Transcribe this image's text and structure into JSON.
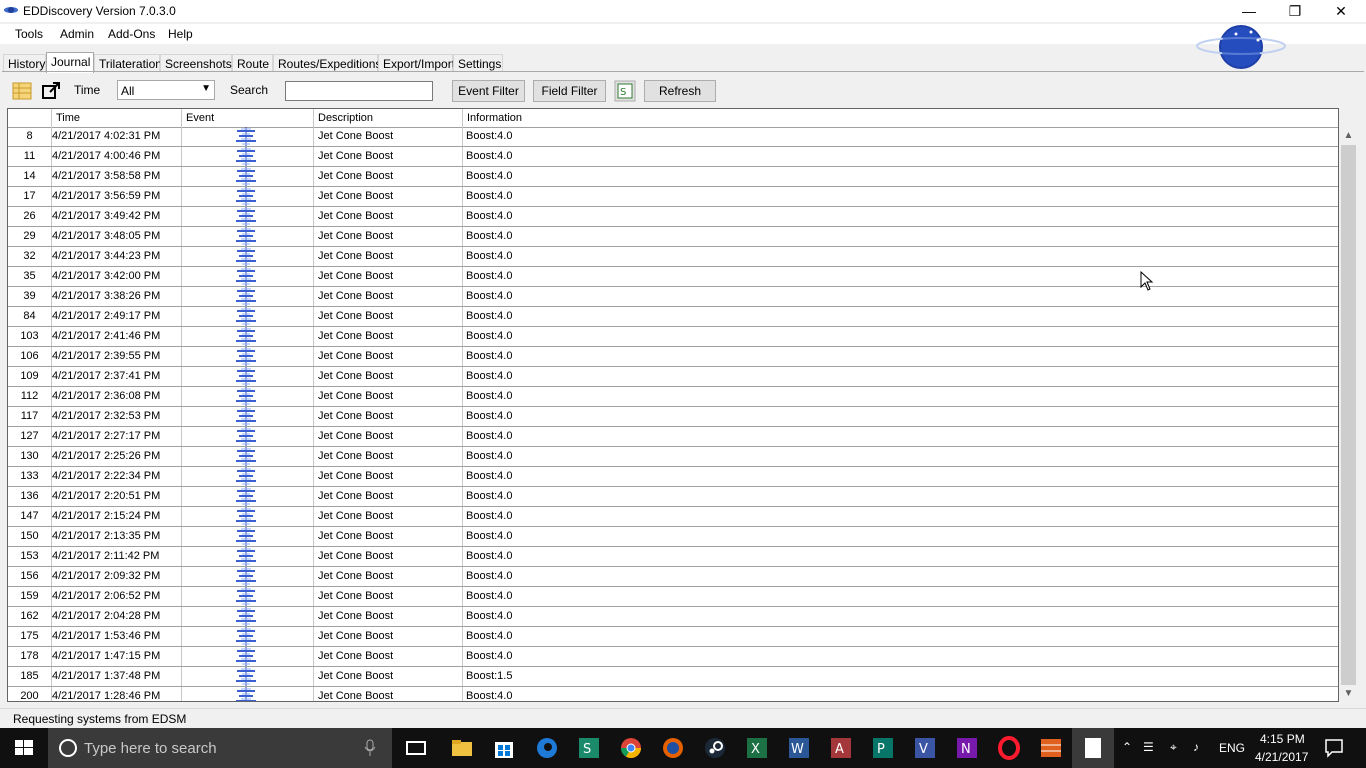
{
  "window": {
    "title": "EDDiscovery Version 7.0.3.0"
  },
  "menu": [
    "Tools",
    "Admin",
    "Add-Ons",
    "Help"
  ],
  "tabs": [
    "History",
    "Journal",
    "Trilateration",
    "Screenshots",
    "Route",
    "Routes/Expeditions",
    "Export/Import",
    "Settings"
  ],
  "active_tab": "Journal",
  "toolbar": {
    "time_label": "Time",
    "time_value": "All",
    "search_label": "Search",
    "search_value": "",
    "event_filter": "Event Filter",
    "field_filter": "Field Filter",
    "refresh": "Refresh"
  },
  "grid": {
    "columns": [
      "",
      "Time",
      "Event",
      "Description",
      "Information"
    ],
    "rows": [
      {
        "idx": "8",
        "time": "4/21/2017 4:02:31 PM",
        "desc": "Jet Cone Boost",
        "info": "Boost:4.0"
      },
      {
        "idx": "11",
        "time": "4/21/2017 4:00:46 PM",
        "desc": "Jet Cone Boost",
        "info": "Boost:4.0"
      },
      {
        "idx": "14",
        "time": "4/21/2017 3:58:58 PM",
        "desc": "Jet Cone Boost",
        "info": "Boost:4.0"
      },
      {
        "idx": "17",
        "time": "4/21/2017 3:56:59 PM",
        "desc": "Jet Cone Boost",
        "info": "Boost:4.0"
      },
      {
        "idx": "26",
        "time": "4/21/2017 3:49:42 PM",
        "desc": "Jet Cone Boost",
        "info": "Boost:4.0"
      },
      {
        "idx": "29",
        "time": "4/21/2017 3:48:05 PM",
        "desc": "Jet Cone Boost",
        "info": "Boost:4.0"
      },
      {
        "idx": "32",
        "time": "4/21/2017 3:44:23 PM",
        "desc": "Jet Cone Boost",
        "info": "Boost:4.0"
      },
      {
        "idx": "35",
        "time": "4/21/2017 3:42:00 PM",
        "desc": "Jet Cone Boost",
        "info": "Boost:4.0"
      },
      {
        "idx": "39",
        "time": "4/21/2017 3:38:26 PM",
        "desc": "Jet Cone Boost",
        "info": "Boost:4.0"
      },
      {
        "idx": "84",
        "time": "4/21/2017 2:49:17 PM",
        "desc": "Jet Cone Boost",
        "info": "Boost:4.0"
      },
      {
        "idx": "103",
        "time": "4/21/2017 2:41:46 PM",
        "desc": "Jet Cone Boost",
        "info": "Boost:4.0"
      },
      {
        "idx": "106",
        "time": "4/21/2017 2:39:55 PM",
        "desc": "Jet Cone Boost",
        "info": "Boost:4.0"
      },
      {
        "idx": "109",
        "time": "4/21/2017 2:37:41 PM",
        "desc": "Jet Cone Boost",
        "info": "Boost:4.0"
      },
      {
        "idx": "112",
        "time": "4/21/2017 2:36:08 PM",
        "desc": "Jet Cone Boost",
        "info": "Boost:4.0"
      },
      {
        "idx": "117",
        "time": "4/21/2017 2:32:53 PM",
        "desc": "Jet Cone Boost",
        "info": "Boost:4.0"
      },
      {
        "idx": "127",
        "time": "4/21/2017 2:27:17 PM",
        "desc": "Jet Cone Boost",
        "info": "Boost:4.0"
      },
      {
        "idx": "130",
        "time": "4/21/2017 2:25:26 PM",
        "desc": "Jet Cone Boost",
        "info": "Boost:4.0"
      },
      {
        "idx": "133",
        "time": "4/21/2017 2:22:34 PM",
        "desc": "Jet Cone Boost",
        "info": "Boost:4.0"
      },
      {
        "idx": "136",
        "time": "4/21/2017 2:20:51 PM",
        "desc": "Jet Cone Boost",
        "info": "Boost:4.0"
      },
      {
        "idx": "147",
        "time": "4/21/2017 2:15:24 PM",
        "desc": "Jet Cone Boost",
        "info": "Boost:4.0"
      },
      {
        "idx": "150",
        "time": "4/21/2017 2:13:35 PM",
        "desc": "Jet Cone Boost",
        "info": "Boost:4.0"
      },
      {
        "idx": "153",
        "time": "4/21/2017 2:11:42 PM",
        "desc": "Jet Cone Boost",
        "info": "Boost:4.0"
      },
      {
        "idx": "156",
        "time": "4/21/2017 2:09:32 PM",
        "desc": "Jet Cone Boost",
        "info": "Boost:4.0"
      },
      {
        "idx": "159",
        "time": "4/21/2017 2:06:52 PM",
        "desc": "Jet Cone Boost",
        "info": "Boost:4.0"
      },
      {
        "idx": "162",
        "time": "4/21/2017 2:04:28 PM",
        "desc": "Jet Cone Boost",
        "info": "Boost:4.0"
      },
      {
        "idx": "175",
        "time": "4/21/2017 1:53:46 PM",
        "desc": "Jet Cone Boost",
        "info": "Boost:4.0"
      },
      {
        "idx": "178",
        "time": "4/21/2017 1:47:15 PM",
        "desc": "Jet Cone Boost",
        "info": "Boost:4.0"
      },
      {
        "idx": "185",
        "time": "4/21/2017 1:37:48 PM",
        "desc": "Jet Cone Boost",
        "info": "Boost:1.5"
      },
      {
        "idx": "200",
        "time": "4/21/2017 1:28:46 PM",
        "desc": "Jet Cone Boost",
        "info": "Boost:4.0"
      }
    ]
  },
  "status": "Requesting systems from EDSM",
  "taskbar": {
    "search_placeholder": "Type here to search",
    "language": "ENG",
    "time": "4:15 PM",
    "date": "4/21/2017"
  }
}
